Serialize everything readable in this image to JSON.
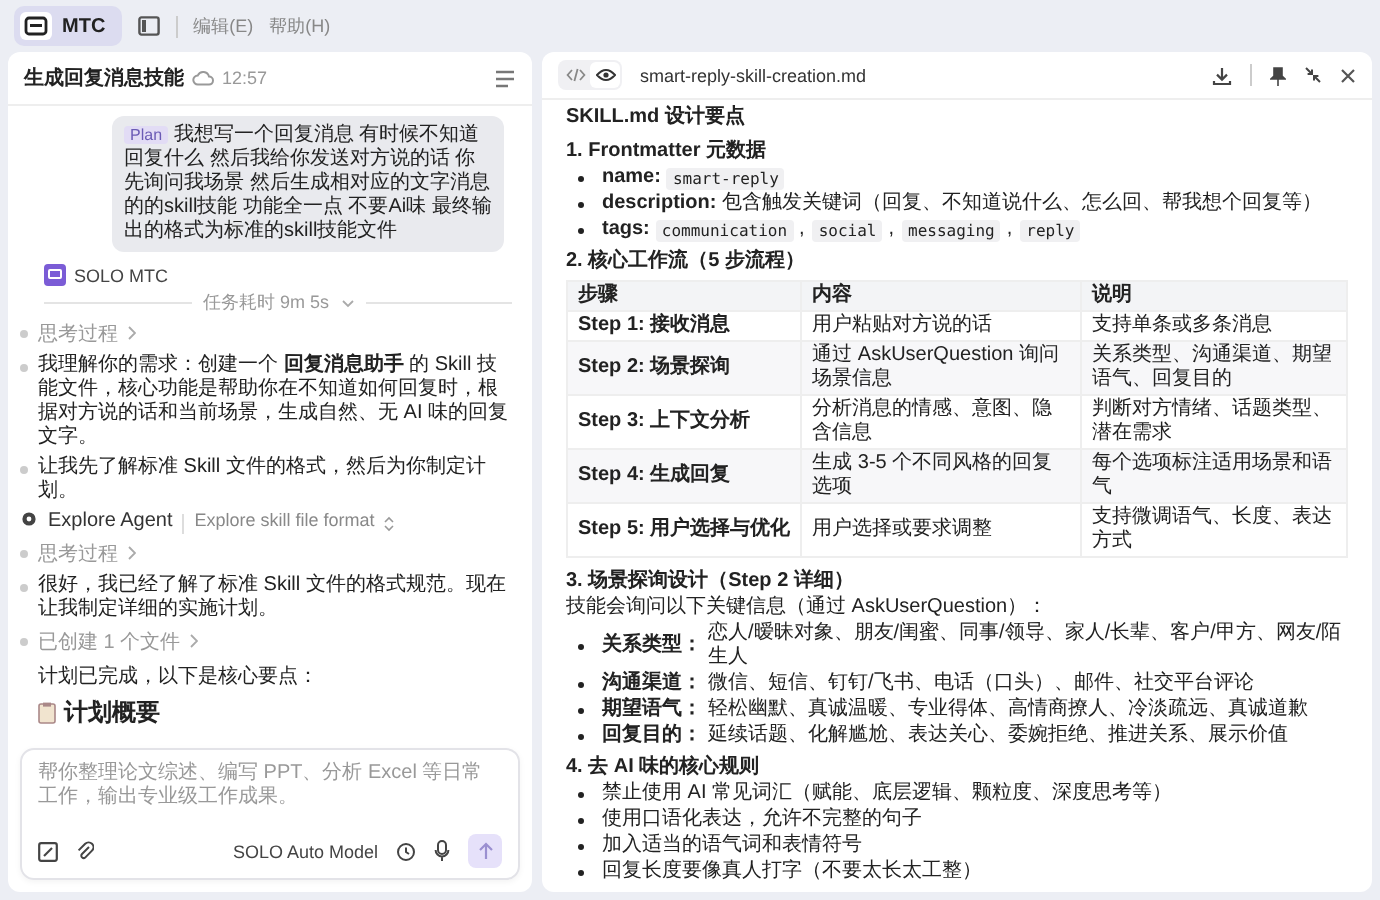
{
  "menu_bar": {
    "app_tab": {
      "label": "MTC",
      "selected": true
    },
    "menus": [
      "编辑(E)",
      "帮助(H)"
    ]
  },
  "chat": {
    "title": "生成回复消息技能",
    "time": "12:57",
    "user_message": {
      "tag": "Plan",
      "text": "我想写一个回复消息 有时候不知道回复什么 然后我给你发送对方说的话 你先询问我场景 然后生成相对应的文字消息的的skill技能 功能全一点 不要Ai味 最终输出的格式为标准的skill技能文件"
    },
    "agent_name": "SOLO MTC",
    "duration": "任务耗时 9m 5s",
    "steps": [
      {
        "kind": "toggle",
        "text": "思考过程"
      },
      {
        "kind": "paragraph",
        "text": "我理解你的需求：创建一个 **回复消息助手** 的 Skill 技能文件，核心功能是帮助你在不知道如何回复时，根据对方说的话和当前场景，生成自然、无 AI 味的回复文字。"
      },
      {
        "kind": "paragraph",
        "text": "让我先了解标准 Skill 文件的格式，然后为你制定计划。"
      },
      {
        "kind": "agent",
        "text": "Explore Agent",
        "detail": "Explore skill file format"
      },
      {
        "kind": "toggle",
        "text": "思考过程"
      },
      {
        "kind": "paragraph",
        "text": "很好，我已经了解了标准 Skill 文件的格式规范。现在让我制定详细的实施计划。"
      },
      {
        "kind": "toggle",
        "text": "已创建 1 个文件"
      },
      {
        "kind": "plain",
        "text": "计划已完成，以下是核心要点："
      },
      {
        "kind": "heading",
        "text": "计划概要"
      }
    ],
    "input": {
      "placeholder": "帮你整理论文综述、编写 PPT、分析 Excel 等日常工作，输出专业级工作成果。",
      "model": "SOLO Auto Model"
    }
  },
  "document": {
    "filename": "smart-reply-skill-creation.md",
    "preview_selected": true,
    "title": "SKILL.md 设计要点",
    "sections": [
      {
        "heading": "1. Frontmatter 元数据",
        "bullets": [
          {
            "label": "name:",
            "codes": [
              "smart-reply"
            ]
          },
          {
            "label": "description:",
            "text": "包含触发关键词（回复、不知道说什么、怎么回、帮我想个回复等）"
          },
          {
            "label": "tags:",
            "codes": [
              "communication",
              "social",
              "messaging",
              "reply"
            ],
            "separator": ","
          }
        ]
      },
      {
        "heading": "2. 核心工作流（5 步流程）",
        "table": {
          "columns": [
            "步骤",
            "内容",
            "说明"
          ],
          "rows": [
            [
              "Step 1: 接收消息",
              "用户粘贴对方说的话",
              "支持单条或多条消息"
            ],
            [
              "Step 2: 场景探询",
              "通过 AskUserQuestion 询问场景信息",
              "关系类型、沟通渠道、期望语气、回复目的"
            ],
            [
              "Step 3: 上下文分析",
              "分析消息的情感、意图、隐含信息",
              "判断对方情绪、话题类型、潜在需求"
            ],
            [
              "Step 4: 生成回复",
              "生成 3-5 个不同风格的回复选项",
              "每个选项标注适用场景和语气"
            ],
            [
              "Step 5: 用户选择与优化",
              "用户选择或要求调整",
              "支持微调语气、长度、表达方式"
            ]
          ]
        }
      },
      {
        "heading": "3. 场景探询设计（Step 2 详细）",
        "intro": "技能会询问以下关键信息（通过 AskUserQuestion）：",
        "bullets": [
          {
            "label": "关系类型：",
            "text": "恋人/暧昧对象、朋友/闺蜜、同事/领导、家人/长辈、客户/甲方、网友/陌生人"
          },
          {
            "label": "沟通渠道：",
            "text": "微信、短信、钉钉/飞书、电话（口头）、邮件、社交平台评论"
          },
          {
            "label": "期望语气：",
            "text": "轻松幽默、真诚温暖、专业得体、高情商撩人、冷淡疏远、真诚道歉"
          },
          {
            "label": "回复目的：",
            "text": "延续话题、化解尴尬、表达关心、委婉拒绝、推进关系、展示价值"
          }
        ]
      },
      {
        "heading": "4. 去 AI 味的核心规则",
        "bullets": [
          {
            "text": "禁止使用 AI 常见词汇（赋能、底层逻辑、颗粒度、深度思考等）"
          },
          {
            "text": "使用口语化表达，允许不完整的句子"
          },
          {
            "text": "加入适当的语气词和表情符号"
          },
          {
            "text": "回复长度要像真人打字（不要太长太工整）"
          }
        ]
      }
    ]
  }
}
